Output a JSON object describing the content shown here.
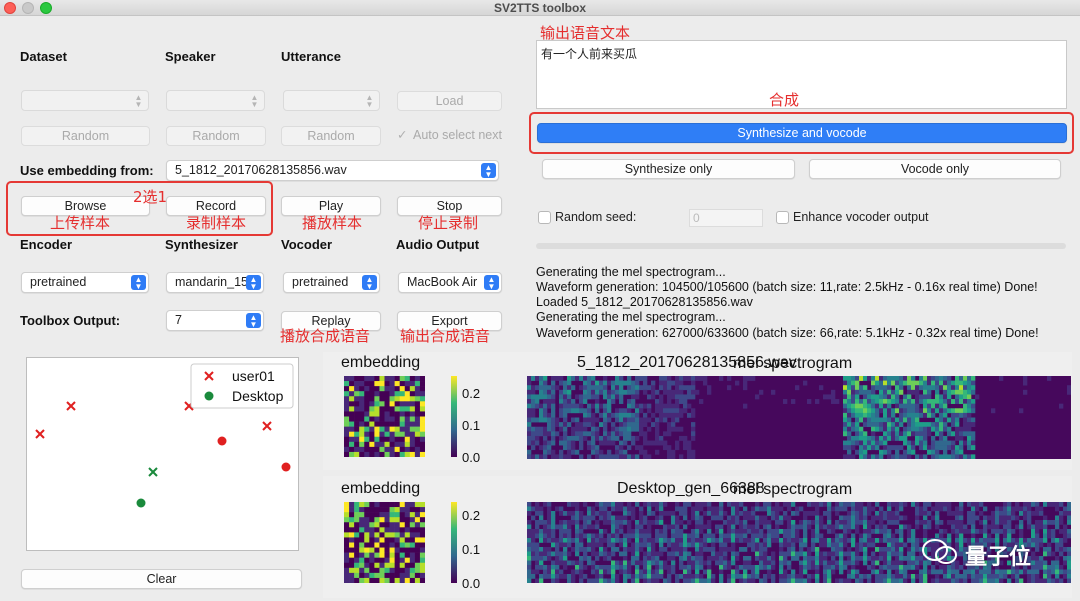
{
  "window": {
    "title": "SV2TTS toolbox"
  },
  "labels": {
    "dataset": "Dataset",
    "speaker": "Speaker",
    "utterance": "Utterance",
    "use_embedding": "Use embedding from:",
    "encoder": "Encoder",
    "synthesizer": "Synthesizer",
    "vocoder": "Vocoder",
    "audio_output": "Audio Output",
    "toolbox_output": "Toolbox Output:"
  },
  "buttons": {
    "load": "Load",
    "random": "Random",
    "browse": "Browse",
    "record": "Record",
    "play": "Play",
    "stop": "Stop",
    "replay": "Replay",
    "export": "Export",
    "synth_vocode": "Synthesize and vocode",
    "synth_only": "Synthesize only",
    "vocode_only": "Vocode only",
    "clear": "Clear"
  },
  "checks": {
    "auto_select": "Auto select next",
    "random_seed": "Random seed:",
    "enhance": "Enhance vocoder output"
  },
  "selects": {
    "embedding_file": "5_1812_20170628135856.wav",
    "encoder": "pretrained",
    "synthesizer": "mandarin_15",
    "vocoder": "pretrained",
    "audio_output": "MacBook Air",
    "toolbox_output": "7"
  },
  "inputs": {
    "seed_placeholder": "0",
    "text": "有一个人前来买瓜"
  },
  "annotations": {
    "output_text": "输出语音文本",
    "synthesize": "合成",
    "choose_one": "2选1",
    "upload_sample": "上传样本",
    "record_sample": "录制样本",
    "play_sample": "播放样本",
    "stop_record": "停止录制",
    "play_synth": "播放合成语音",
    "export_synth": "输出合成语音"
  },
  "log": [
    "Generating the mel spectrogram...",
    "Waveform generation: 104500/105600 (batch size: 11,rate: 2.5kHz - 0.16x real time) Done!",
    "Loaded 5_1812_20170628135856.wav",
    "Generating the mel spectrogram...",
    "Waveform generation: 627000/633600 (batch size: 66,rate: 5.1kHz - 0.32x real time) Done!"
  ],
  "scatter": {
    "legend": [
      {
        "name": "user01",
        "color": "#e02020"
      },
      {
        "name": "Desktop",
        "color": "#1a8a3c"
      }
    ]
  },
  "plots": {
    "row1": {
      "embed_title": "embedding",
      "spec_title": "5_1812_20170628135856.wav",
      "spec_overlay": "mel spectrogram"
    },
    "row2": {
      "embed_title": "embedding",
      "spec_title": "Desktop_gen_66388",
      "spec_overlay": "mel spectrogram"
    },
    "colorbar_ticks": [
      "0.2",
      "0.1",
      "0.0"
    ]
  },
  "watermark": "量子位"
}
